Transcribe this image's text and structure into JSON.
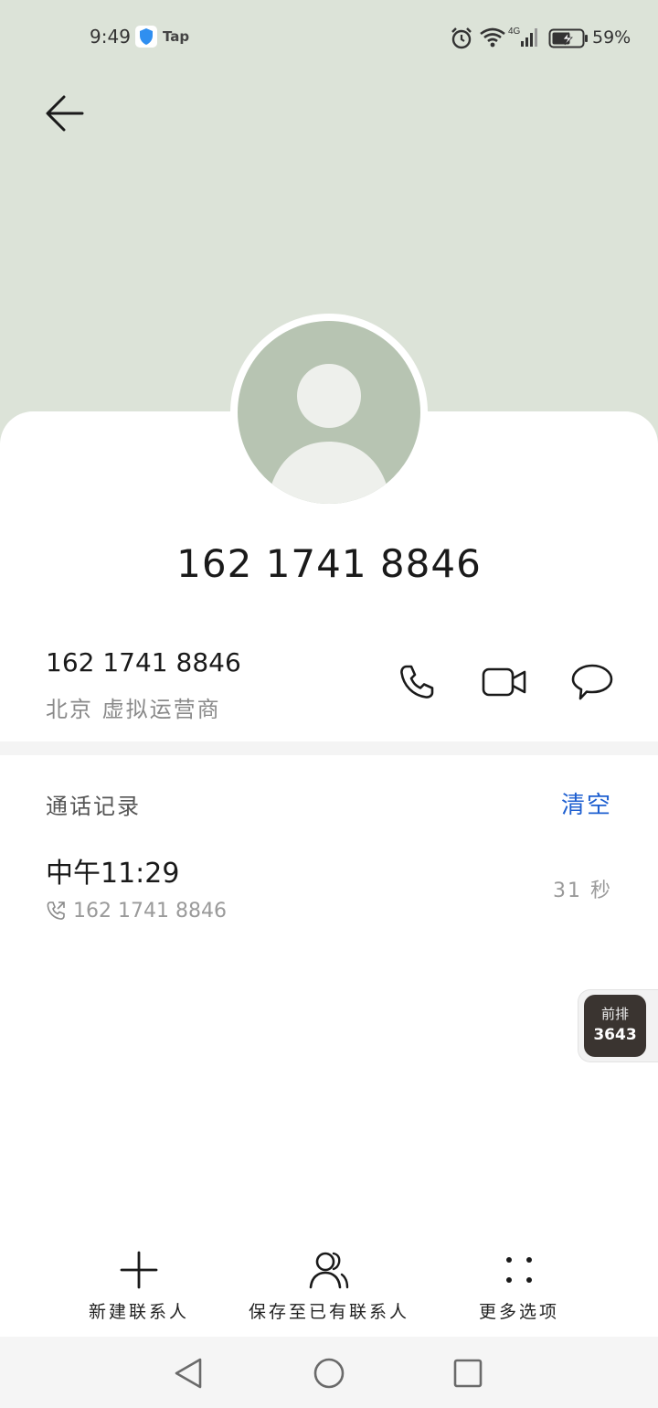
{
  "status_bar": {
    "time": "9:49",
    "app_label": "Tap",
    "network": "4G",
    "battery_pct": "59%"
  },
  "contact": {
    "display_number": "162 1741 8846"
  },
  "number_row": {
    "number": "162 1741 8846",
    "carrier": "北京 虚拟运营商"
  },
  "call_log": {
    "title": "通话记录",
    "clear_label": "清空",
    "entries": [
      {
        "time": "中午11:29",
        "number": "162 1741 8846",
        "duration": "31 秒"
      }
    ]
  },
  "floating_badge": {
    "top_text": "前排",
    "number": "3643"
  },
  "bottom_actions": {
    "new_contact": "新建联系人",
    "save_existing": "保存至已有联系人",
    "more": "更多选项"
  },
  "colors": {
    "header_bg": "#dce3d8",
    "accent": "#1e5fd0",
    "avatar_bg": "#b7c4b2"
  }
}
